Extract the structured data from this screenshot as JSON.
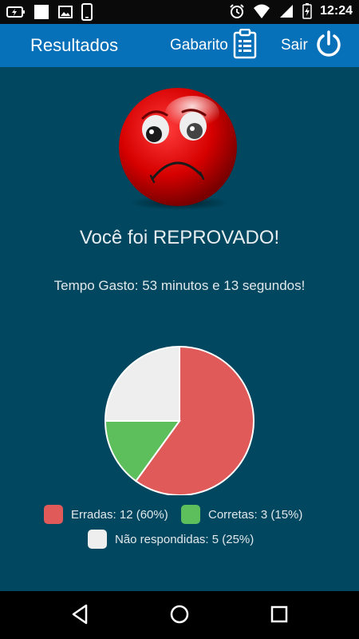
{
  "status_bar": {
    "time": "12:24",
    "icons_left": [
      "battery-charging-icon",
      "notification-square-icon",
      "image-icon",
      "phone-icon"
    ],
    "icons_right": [
      "alarm-icon",
      "wifi-icon",
      "signal-icon",
      "battery-icon"
    ]
  },
  "toolbar": {
    "title": "Resultados",
    "gabarito_label": "Gabarito",
    "sair_label": "Sair",
    "background": "#0670b8"
  },
  "result": {
    "message": "Você foi REPROVADO!",
    "time_spent": "Tempo Gasto: 53 minutos e 13 segundos!"
  },
  "chart_data": {
    "type": "pie",
    "slices": [
      {
        "label": "Erradas",
        "value": 12,
        "percent": 60,
        "color": "#e05a5a"
      },
      {
        "label": "Corretas",
        "value": 3,
        "percent": 15,
        "color": "#5cbf5c"
      },
      {
        "label": "Não respondidas",
        "value": 5,
        "percent": 25,
        "color": "#eeeeee"
      }
    ],
    "legend": [
      "Erradas: 12 (60%)",
      "Corretas: 3 (15%)",
      "Não respondidas: 5 (25%)"
    ],
    "legend_placement": "bottom"
  },
  "colors": {
    "background": "#00475f",
    "status_bar": "#0a0a0a",
    "nav_bar": "#000000"
  },
  "nav": {
    "icons": [
      "back-icon",
      "home-icon",
      "recents-icon"
    ]
  }
}
